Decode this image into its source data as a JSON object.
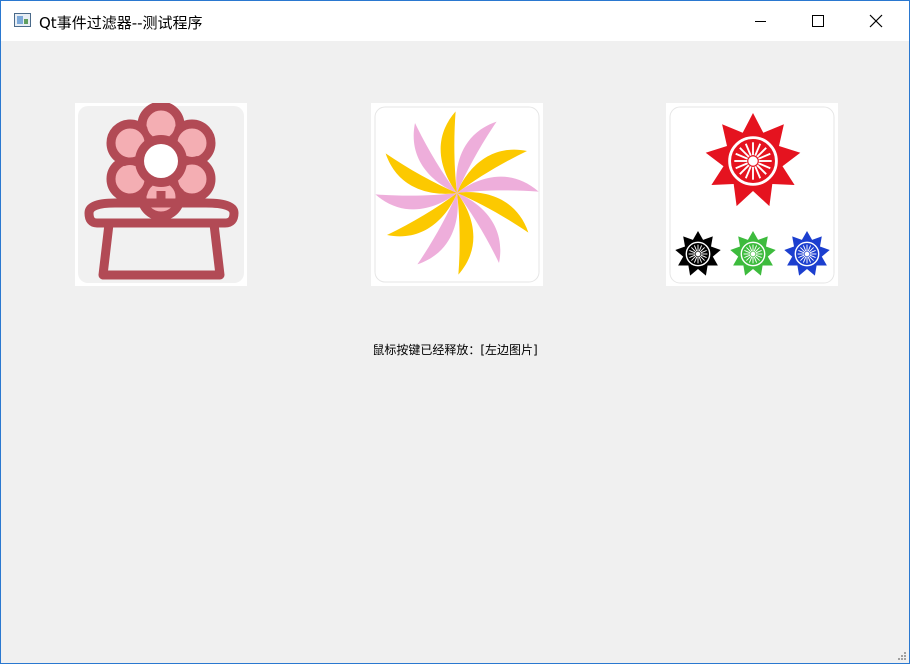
{
  "window": {
    "title": "Qt事件过滤器--测试程序",
    "icon": "qt-app-icon",
    "controls": [
      "minimize-icon",
      "maximize-icon",
      "close-icon"
    ]
  },
  "images": [
    {
      "id": "left",
      "icon": "flower-pot-icon"
    },
    {
      "id": "middle",
      "icon": "pinwheel-icon"
    },
    {
      "id": "right",
      "icon": "sunflowers-icon"
    }
  ],
  "status": {
    "text": "鼠标按键已经释放：[左边图片]"
  },
  "colors": {
    "title_bar": "#ffffff",
    "client_bg": "#f0f0f0",
    "window_border": "#2a78d0",
    "pot_stroke": "#b24a55",
    "petal_pink": "#f4aeb3",
    "pinwheel_yellow": "#fcc900",
    "pinwheel_pink": "#eeaedb",
    "flower_red": "#e5131f",
    "flower_black": "#000000",
    "flower_green": "#3dbb3d",
    "flower_blue": "#1c3fcf"
  }
}
